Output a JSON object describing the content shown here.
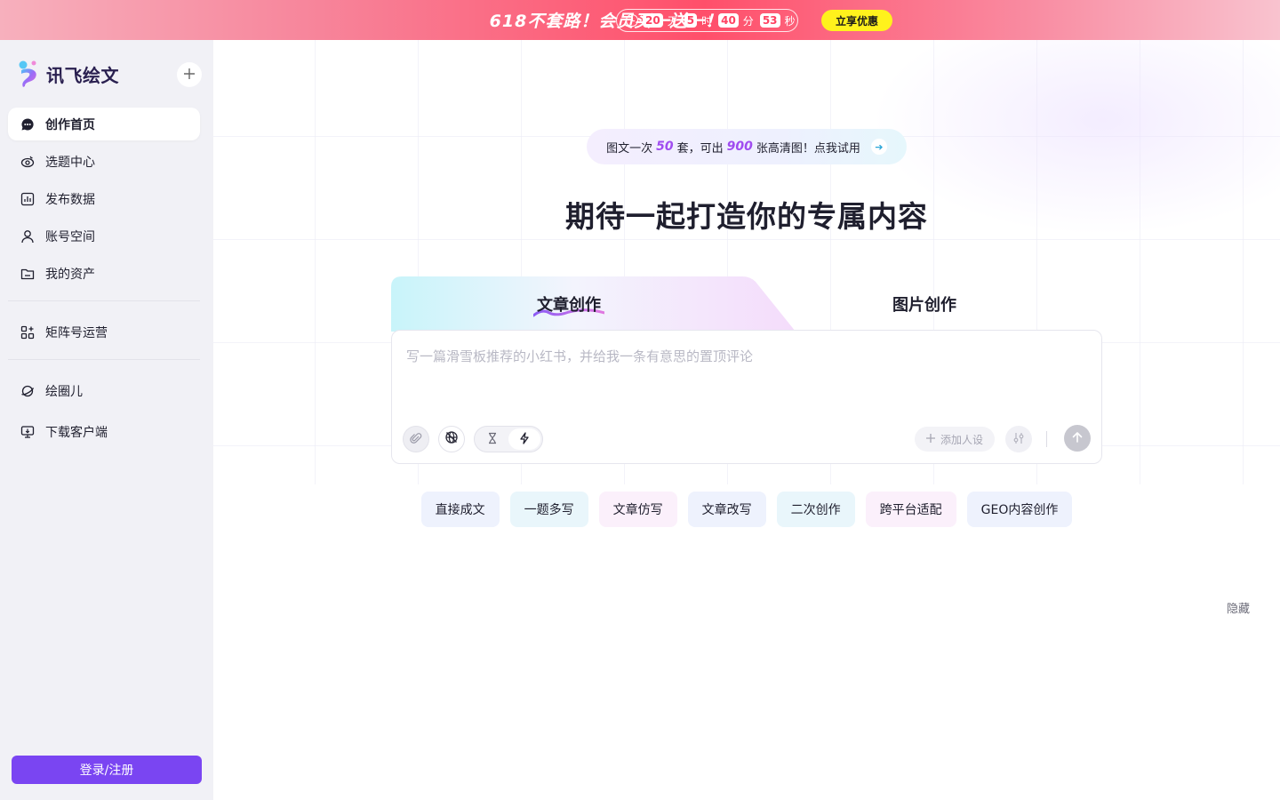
{
  "promo": {
    "title": "618不套路！会员买一送一！",
    "countdown": {
      "days": "20",
      "days_unit": "天",
      "hours": "5",
      "hours_unit": "时",
      "minutes": "40",
      "minutes_unit": "分",
      "seconds": "53",
      "seconds_unit": "秒"
    },
    "cta": "立享优惠"
  },
  "sidebar": {
    "brand": "讯飞绘文",
    "primary_nav": [
      {
        "label": "创作首页",
        "icon": "chat-bubble-icon",
        "active": true
      },
      {
        "label": "选题中心",
        "icon": "eye-target-icon",
        "active": false
      },
      {
        "label": "发布数据",
        "icon": "bar-chart-icon",
        "active": false
      },
      {
        "label": "账号空间",
        "icon": "user-icon",
        "active": false
      },
      {
        "label": "我的资产",
        "icon": "folder-icon",
        "active": false
      }
    ],
    "matrix_nav": [
      {
        "label": "矩阵号运营",
        "icon": "grid-apps-icon"
      }
    ],
    "extra_nav": [
      {
        "label": "绘圈儿",
        "icon": "planet-icon"
      },
      {
        "label": "下载客户端",
        "icon": "monitor-download-icon"
      }
    ],
    "login": "登录/注册"
  },
  "main": {
    "promo_pill": {
      "prefix": "图文一次",
      "num1": "50",
      "mid": "套，可出",
      "num2": "900",
      "suffix": "张高清图！点我试用"
    },
    "headline": "期待一起打造你的专属内容",
    "tabs": [
      {
        "label": "文章创作",
        "active": true
      },
      {
        "label": "图片创作",
        "active": false
      }
    ],
    "composer": {
      "placeholder": "写一篇滑雪板推荐的小红书，并给我一条有意思的置顶评论",
      "persona": "添加人设"
    },
    "chips": [
      "直接成文",
      "一题多写",
      "文章仿写",
      "文章改写",
      "二次创作",
      "跨平台适配",
      "GEO内容创作"
    ],
    "hide": "隐藏"
  },
  "colors": {
    "accent": "#7a45f2",
    "promo_red": "#ff4f6a",
    "promo_cta": "#fff21c",
    "highlight_purple": "#a04cf0"
  }
}
